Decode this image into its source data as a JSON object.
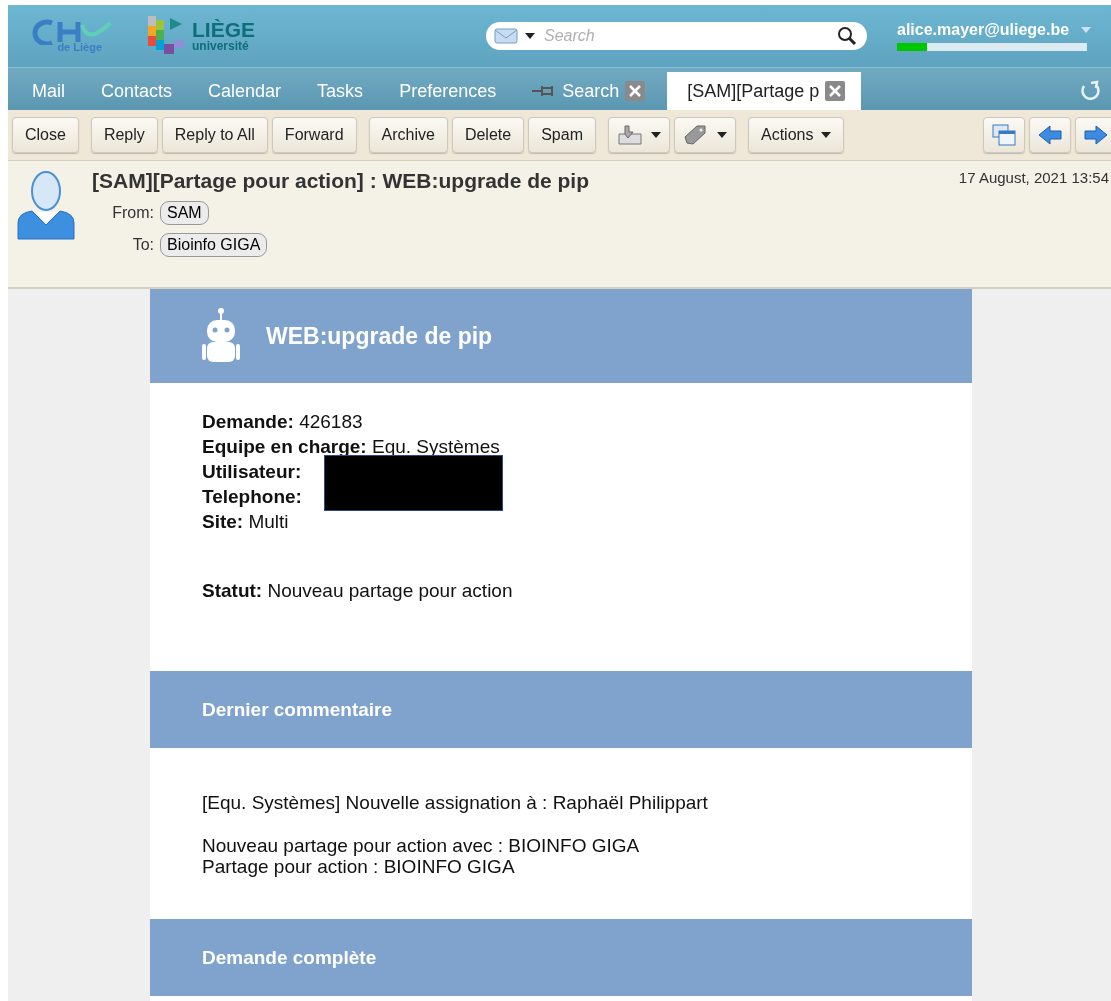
{
  "header": {
    "search": {
      "placeholder": "Search"
    },
    "user": {
      "email": "alice.mayer@uliege.be",
      "quota": {
        "level": 0.16
      }
    },
    "logos": [
      {
        "kind": "chu",
        "text": "de Liège"
      },
      {
        "kind": "uliege",
        "title": "LIÈGE",
        "subtitle": "université"
      }
    ]
  },
  "tabs": [
    {
      "label": "Mail",
      "selected": false,
      "pinned": false,
      "closable": false
    },
    {
      "label": "Contacts",
      "selected": false,
      "pinned": false,
      "closable": false
    },
    {
      "label": "Calendar",
      "selected": false,
      "pinned": false,
      "closable": false
    },
    {
      "label": "Tasks",
      "selected": false,
      "pinned": false,
      "closable": false
    },
    {
      "label": "Preferences",
      "selected": false,
      "pinned": false,
      "closable": false
    },
    {
      "label": "Search",
      "selected": false,
      "pinned": true,
      "closable": true
    },
    {
      "label": "[SAM][Partage p",
      "selected": true,
      "pinned": false,
      "closable": true
    }
  ],
  "toolbar": {
    "groups": [
      [
        {
          "kind": "text",
          "label": "Close"
        }
      ],
      [
        {
          "kind": "text",
          "label": "Reply"
        },
        {
          "kind": "text",
          "label": "Reply to All"
        },
        {
          "kind": "text",
          "label": "Forward"
        }
      ],
      [
        {
          "kind": "text",
          "label": "Archive"
        },
        {
          "kind": "text",
          "label": "Delete"
        },
        {
          "kind": "text",
          "label": "Spam"
        }
      ],
      [
        {
          "kind": "move"
        },
        {
          "kind": "tag"
        }
      ],
      [
        {
          "kind": "menu",
          "label": "Actions"
        }
      ]
    ],
    "nav": [
      {
        "kind": "window"
      },
      {
        "kind": "prev"
      },
      {
        "kind": "next"
      }
    ]
  },
  "message": {
    "subject": "[SAM][Partage pour action] : WEB:upgrade de pip",
    "date": "17 August, 2021 13:54",
    "from_label": "From:",
    "from": "SAM",
    "to_label": "To:",
    "to": "Bioinfo GIGA"
  },
  "body": {
    "title": "WEB:upgrade de pip",
    "fields": [
      {
        "label": "Demande:",
        "value": "426183"
      },
      {
        "label": "Equipe en charge:",
        "value": "Equ. Systèmes"
      },
      {
        "label": "Utilisateur:",
        "redacted": true
      },
      {
        "label": "Telephone:",
        "redacted": true
      },
      {
        "label": "Site:",
        "value": "Multi"
      }
    ],
    "status": {
      "label": "Statut:",
      "value": "Nouveau partage pour action"
    },
    "sections": [
      {
        "title": "Dernier commentaire",
        "paragraphs": [
          [
            "[Equ. Systèmes] Nouvelle assignation à : Raphaël Philippart"
          ],
          [
            "Nouveau partage pour action avec : BIOINFO GIGA",
            "Partage pour action : BIOINFO GIGA"
          ]
        ]
      },
      {
        "title": "Demande complète"
      }
    ]
  }
}
